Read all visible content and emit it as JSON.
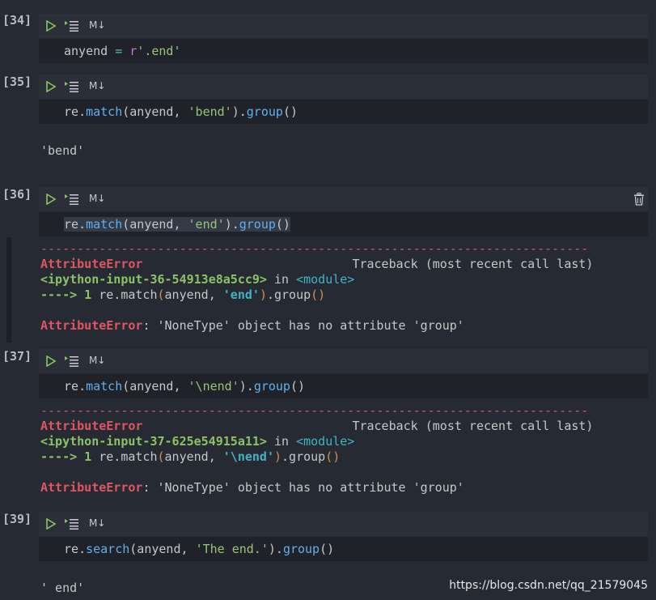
{
  "cells": [
    {
      "prompt": "[34]",
      "md": "M↓",
      "code": [
        "anyend",
        " = ",
        "r",
        "'.end'"
      ]
    },
    {
      "prompt": "[35]",
      "md": "M↓",
      "code": [
        "re",
        ".",
        "match",
        "(anyend, ",
        "'bend'",
        ").",
        "group",
        "()"
      ],
      "output": "'bend'"
    },
    {
      "prompt": "[36]",
      "md": "M↓",
      "code": [
        "re",
        ".",
        "match",
        "(anyend, ",
        "'end'",
        ").",
        "group",
        "()"
      ],
      "error": {
        "dashes": "---------------------------------------------------------------------------",
        "name": "AttributeError",
        "traceback": "Traceback (most recent call last)",
        "input": "<ipython-input-36-54913e8a5cc9>",
        "in": " in ",
        "module": "<module>",
        "arrow": "----> 1 ",
        "line_pre": "re.match",
        "line_paren": "(",
        "line_mid": "anyend, ",
        "line_str": "'end'",
        "line_close": ")",
        "line_post": ".group",
        "line_end": "()",
        "msg": ": 'NoneType' object has no attribute 'group'"
      }
    },
    {
      "prompt": "[37]",
      "md": "M↓",
      "code": [
        "re",
        ".",
        "match",
        "(anyend, ",
        "'\\nend'",
        ").",
        "group",
        "()"
      ],
      "error": {
        "dashes": "---------------------------------------------------------------------------",
        "name": "AttributeError",
        "traceback": "Traceback (most recent call last)",
        "input": "<ipython-input-37-625e54915a11>",
        "in": " in ",
        "module": "<module>",
        "arrow": "----> 1 ",
        "line_pre": "re.match",
        "line_paren": "(",
        "line_mid": "anyend, ",
        "line_str": "'\\nend'",
        "line_close": ")",
        "line_post": ".group",
        "line_end": "()",
        "msg": ": 'NoneType' object has no attribute 'group'"
      }
    },
    {
      "prompt": "[39]",
      "md": "M↓",
      "code": [
        "re",
        ".",
        "search",
        "(anyend, ",
        "'The end.'",
        ").",
        "group",
        "()"
      ],
      "output": "' end'"
    }
  ],
  "watermark": "https://blog.csdn.net/qq_21579045",
  "colors": {
    "background": "#262a33",
    "toolbar": "#2b2f37",
    "editor": "#1f2229",
    "error": "#e05561",
    "string": "#98c379",
    "function": "#61afef"
  }
}
